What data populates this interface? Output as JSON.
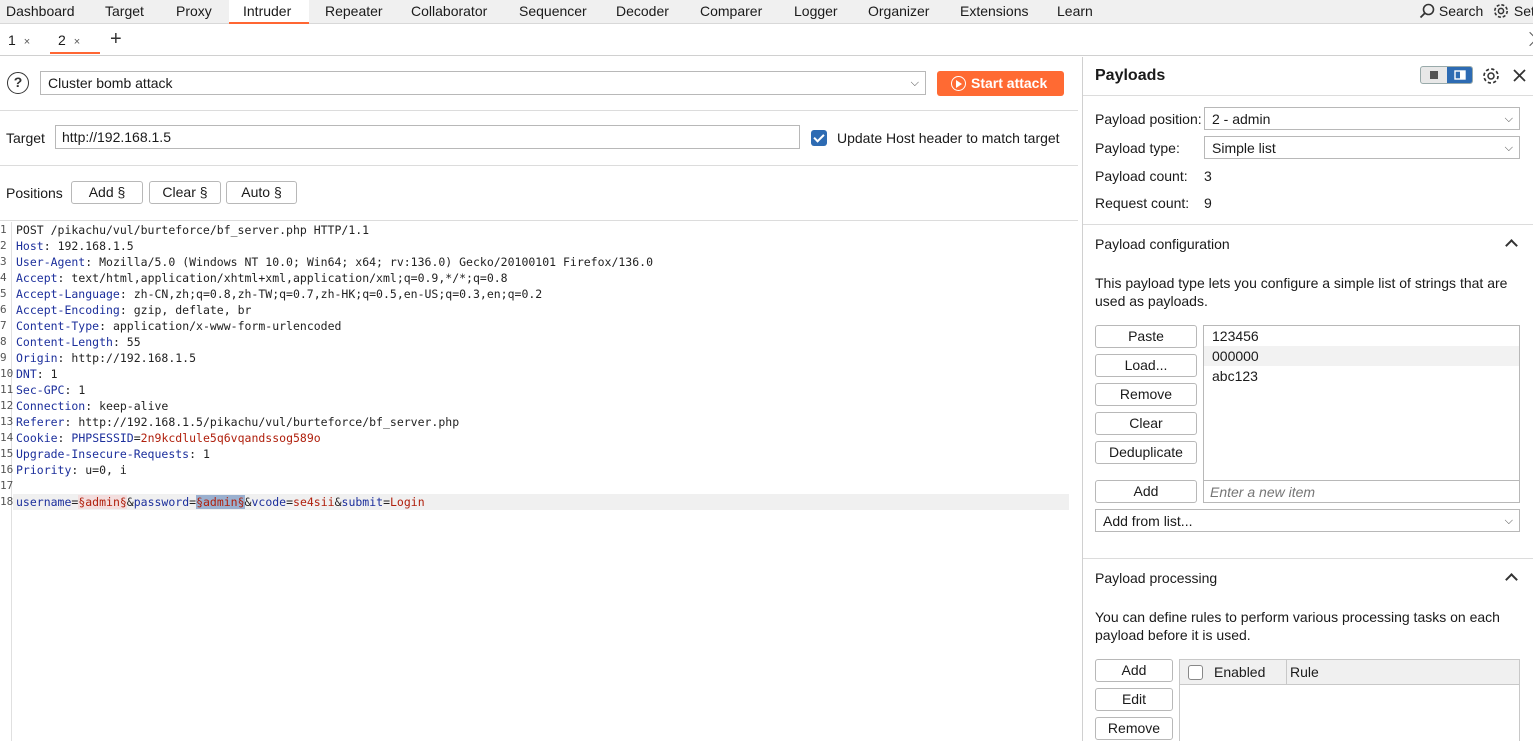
{
  "menu": {
    "tabs": [
      "Dashboard",
      "Target",
      "Proxy",
      "Intruder",
      "Repeater",
      "Collaborator",
      "Sequencer",
      "Decoder",
      "Comparer",
      "Logger",
      "Organizer",
      "Extensions",
      "Learn"
    ],
    "search_label": "Search",
    "settings_label": "Set"
  },
  "subtabs": [
    {
      "label": "1",
      "close": "×"
    },
    {
      "label": "2",
      "close": "×"
    }
  ],
  "new_tab": "+",
  "attack": {
    "help": "?",
    "type": "Cluster bomb attack",
    "start_label": "Start attack"
  },
  "target": {
    "label": "Target",
    "value": "http://192.168.1.5",
    "update_host_label": "Update Host header to match target"
  },
  "positions": {
    "label": "Positions",
    "add_label": "Add §",
    "clear_label": "Clear §",
    "auto_label": "Auto §"
  },
  "request": {
    "line1": "POST /pikachu/vul/burteforce/bf_server.php HTTP/1.1",
    "headers": [
      {
        "n": "2",
        "k": "Host",
        "v": " 192.168.1.5"
      },
      {
        "n": "3",
        "k": "User-Agent",
        "v": " Mozilla/5.0 (Windows NT 10.0; Win64; x64; rv:136.0) Gecko/20100101 Firefox/136.0"
      },
      {
        "n": "4",
        "k": "Accept",
        "v": " text/html,application/xhtml+xml,application/xml;q=0.9,*/*;q=0.8"
      },
      {
        "n": "5",
        "k": "Accept-Language",
        "v": " zh-CN,zh;q=0.8,zh-TW;q=0.7,zh-HK;q=0.5,en-US;q=0.3,en;q=0.2"
      },
      {
        "n": "6",
        "k": "Accept-Encoding",
        "v": " gzip, deflate, br"
      },
      {
        "n": "7",
        "k": "Content-Type",
        "v": " application/x-www-form-urlencoded"
      },
      {
        "n": "8",
        "k": "Content-Length",
        "v": " 55"
      },
      {
        "n": "9",
        "k": "Origin",
        "v": " http://192.168.1.5"
      },
      {
        "n": "10",
        "k": "DNT",
        "v": " 1"
      },
      {
        "n": "11",
        "k": "Sec-GPC",
        "v": " 1"
      },
      {
        "n": "12",
        "k": "Connection",
        "v": " keep-alive"
      },
      {
        "n": "13",
        "k": "Referer",
        "v": " http://192.168.1.5/pikachu/vul/burteforce/bf_server.php"
      },
      {
        "n": "14",
        "k": "Cookie",
        "v": " "
      },
      {
        "n": "15",
        "k": "Upgrade-Insecure-Requests",
        "v": " 1"
      },
      {
        "n": "16",
        "k": "Priority",
        "v": " u=0, i"
      }
    ],
    "cookie_name": "PHPSESSID",
    "cookie_eq": "=",
    "cookie_value": "2n9kcdlule5q6vqandssog589o",
    "body": {
      "p1": "username",
      "eq": "=",
      "m1": "§admin§",
      "amp1": "&",
      "p2": "password",
      "m2": "§admin§",
      "amp2": "&",
      "p3": "vcode",
      "v3": "se4sii",
      "amp3": "&",
      "p4": "submit",
      "v4": "Login"
    }
  },
  "payloads": {
    "title": "Payloads",
    "position_label": "Payload position:",
    "position_value": "2 - admin",
    "type_label": "Payload type:",
    "type_value": "Simple list",
    "count_label": "Payload count:",
    "count_value": "3",
    "request_label": "Request count:",
    "request_value": "9"
  },
  "config": {
    "title": "Payload configuration",
    "desc": "This payload type lets you configure a simple list of strings that are used as payloads.",
    "buttons": [
      "Paste",
      "Load...",
      "Remove",
      "Clear",
      "Deduplicate"
    ],
    "items": [
      "123456",
      "000000",
      "abc123"
    ],
    "add_label": "Add",
    "new_item_placeholder": "Enter a new item",
    "add_from_list": "Add from list..."
  },
  "processing": {
    "title": "Payload processing",
    "desc": "You can define rules to perform various processing tasks on each payload before it is used.",
    "buttons": [
      "Add",
      "Edit",
      "Remove"
    ],
    "col_enabled": "Enabled",
    "col_rule": "Rule"
  },
  "colors": {
    "accent": "#ff6a33",
    "checkbox": "#2d6bb3",
    "header_key": "#1c2f9c",
    "value_red": "#b0200d"
  }
}
